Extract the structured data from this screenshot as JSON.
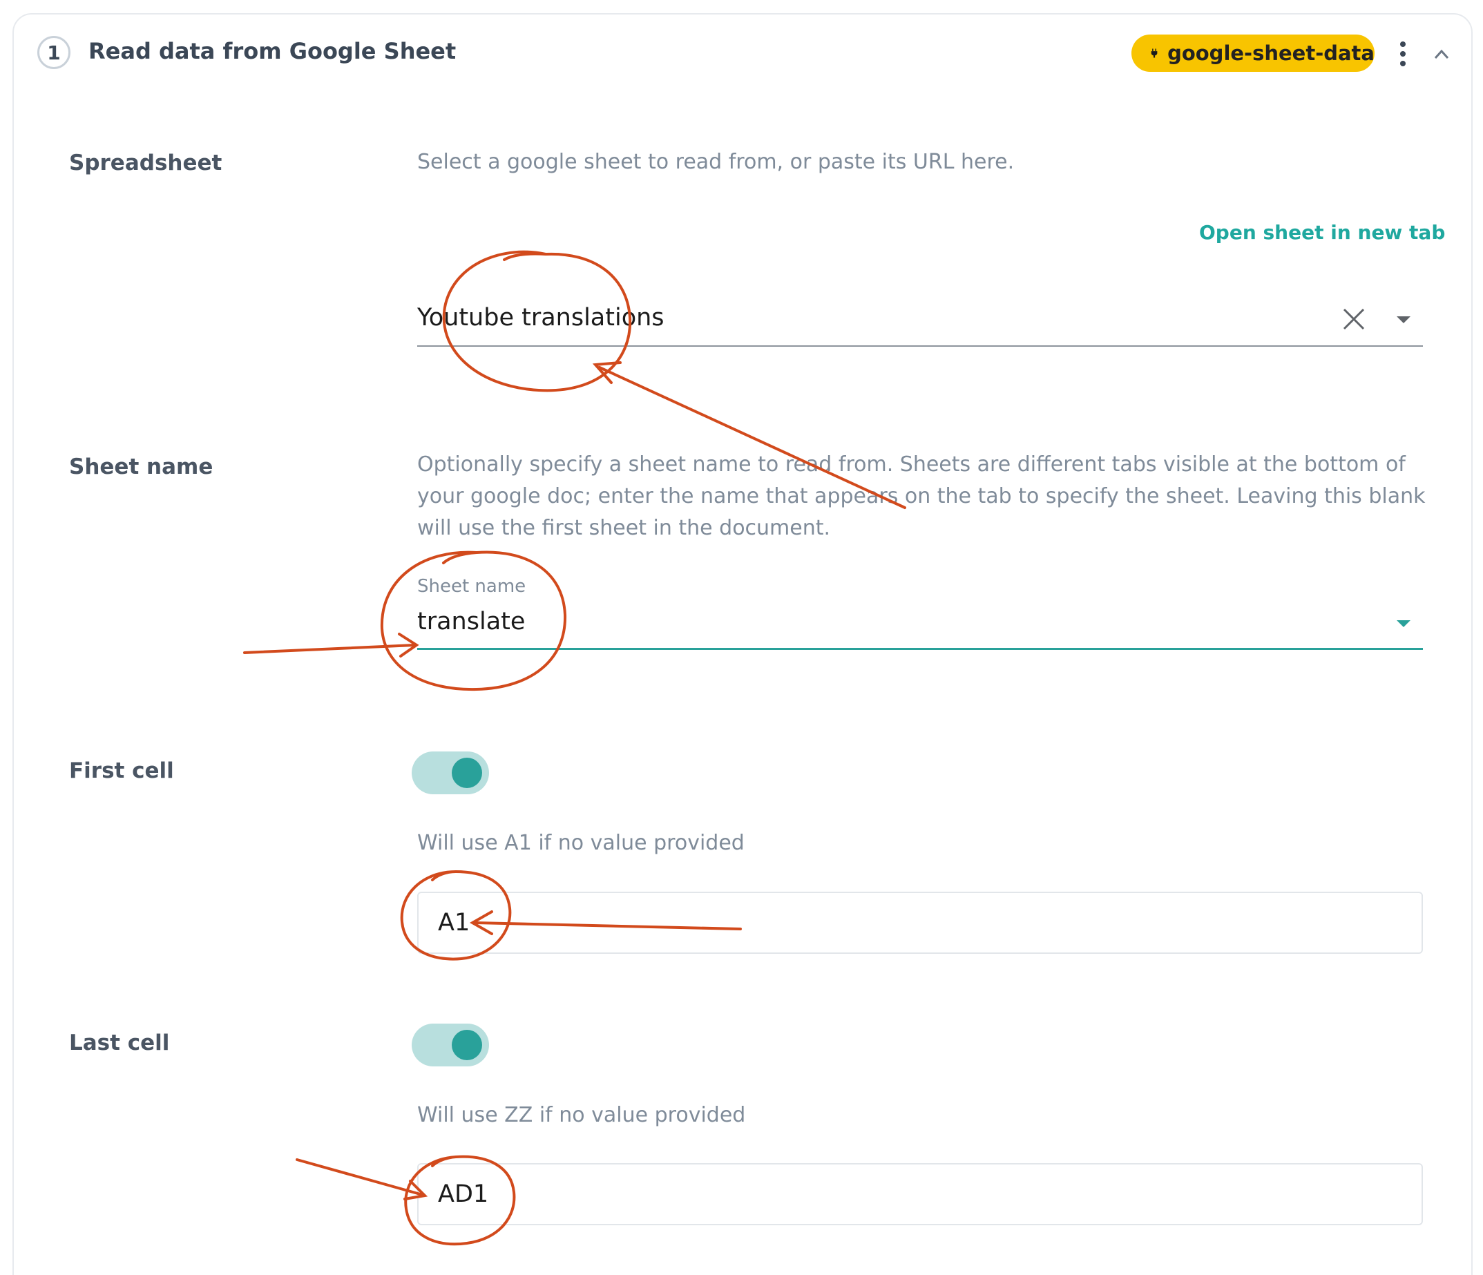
{
  "step": {
    "number": "1",
    "title": "Read data from Google Sheet",
    "connection_label": "google-sheet-data",
    "connection_color": "#f8c400",
    "icons": {
      "connection": "plug-icon",
      "menu": "kebab-menu-icon",
      "collapse": "chevron-up-icon"
    }
  },
  "fields": {
    "spreadsheet": {
      "label": "Spreadsheet",
      "help": "Select a google sheet to read from, or paste its URL here.",
      "link_label": "Open sheet in new tab",
      "value": "Youtube translations"
    },
    "sheet_name": {
      "label": "Sheet name",
      "help": "Optionally specify a sheet name to read from. Sheets are different tabs visible at the bottom of your google doc; enter the name that appears on the tab to specify the sheet. Leaving this blank will use the first sheet in the document.",
      "float_label": "Sheet name",
      "value": "translate"
    },
    "first_cell": {
      "label": "First cell",
      "toggle_on": true,
      "help": "Will use A1 if no value provided",
      "value": "A1"
    },
    "last_cell": {
      "label": "Last cell",
      "toggle_on": true,
      "help": "Will use ZZ if no value provided",
      "value": "AD1"
    }
  },
  "colors": {
    "accent": "#29a19a",
    "link": "#1fa89f",
    "annotation": "#d24a1c"
  }
}
